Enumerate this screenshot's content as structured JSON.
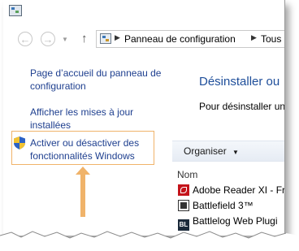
{
  "window": {
    "app_icon": "control-panel-icon"
  },
  "nav": {
    "back_icon": "←",
    "forward_icon": "→",
    "dropdown_icon": "▼",
    "up_icon": "↑",
    "breadcrumb": [
      "Panneau de configuration",
      "Tous les"
    ],
    "separator": "▶"
  },
  "left_pane": {
    "links": [
      "Page d’accueil du panneau de configuration",
      "Afficher les mises à jour installées",
      "Activer ou désactiver des fonctionnalités Windows"
    ],
    "link_lines": [
      [
        "Page d’accueil du panneau de",
        "configuration"
      ],
      [
        "Afficher les mises à jour",
        "installées"
      ],
      [
        "Activer ou désactiver des",
        "fonctionnalités Windows"
      ]
    ],
    "highlight_color": "#f0b36a",
    "shield_icon": "uac-shield-icon"
  },
  "main": {
    "heading": "Désinstaller ou",
    "description": "Pour désinstaller un p",
    "toolbar": {
      "organize_label": "Organiser",
      "organize_caret": "▼"
    },
    "column_header": "Nom",
    "programs": [
      {
        "name": "Adobe Reader XI - Fran",
        "icon": "adobe-reader-icon"
      },
      {
        "name": "Battlefield 3™",
        "icon": "battlefield-icon"
      },
      {
        "name": "Battlelog Web Plugi",
        "icon": "battlelog-icon",
        "icon_text": "BL"
      }
    ]
  },
  "colors": {
    "link": "#1e3f8f",
    "heading": "#1e4e9a",
    "annotation": "#f0b36a"
  }
}
